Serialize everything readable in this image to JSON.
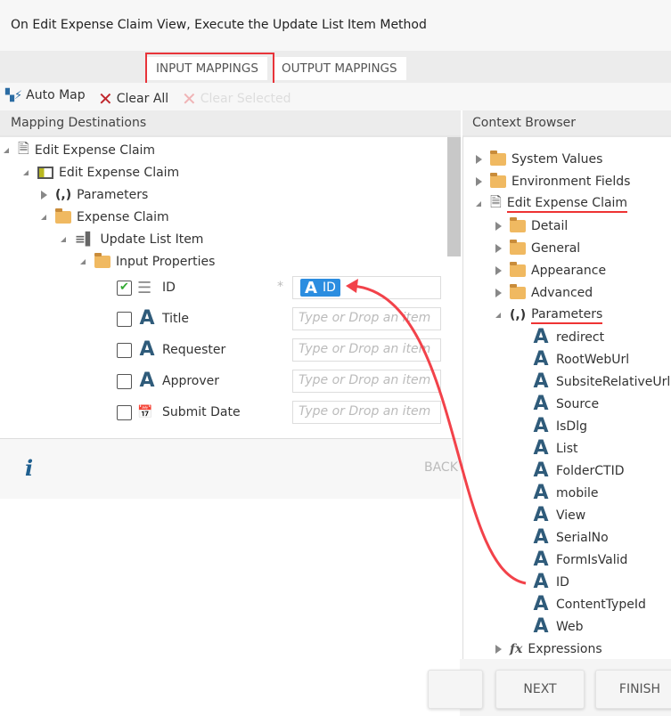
{
  "title": "On Edit Expense Claim View, Execute the Update List Item Method",
  "tabs": {
    "input": "INPUT MAPPINGS",
    "output": "OUTPUT MAPPINGS"
  },
  "toolbar": {
    "auto_map": "Auto Map",
    "clear_all": "Clear All",
    "clear_selected": "Clear Selected"
  },
  "left": {
    "header": "Mapping Destinations",
    "tree": {
      "root": "Edit Expense Claim",
      "view": "Edit Expense Claim",
      "parameters": "Parameters",
      "expense_claim": "Expense Claim",
      "method": "Update List Item",
      "input_props": "Input Properties"
    },
    "props": [
      {
        "label": "ID",
        "checked": true,
        "value": "ID",
        "required_mark": "*"
      },
      {
        "label": "Title",
        "placeholder": "Type or Drop an item"
      },
      {
        "label": "Requester",
        "placeholder": "Type or Drop an item"
      },
      {
        "label": "Approver",
        "placeholder": "Type or Drop an item"
      },
      {
        "label": "Submit Date",
        "placeholder": "Type or Drop an item"
      }
    ]
  },
  "footer": {
    "info": "i",
    "back": "BACK",
    "next": "NEXT",
    "finish": "FINISH"
  },
  "right": {
    "header": "Context Browser",
    "system_values": "System Values",
    "environment_fields": "Environment Fields",
    "edit_expense_claim": "Edit Expense Claim",
    "detail": "Detail",
    "general": "General",
    "appearance": "Appearance",
    "advanced": "Advanced",
    "parameters": "Parameters",
    "params": [
      "redirect",
      "RootWebUrl",
      "SubsiteRelativeUrl",
      "Source",
      "IsDlg",
      "List",
      "FolderCTID",
      "mobile",
      "View",
      "SerialNo",
      "FormIsValid",
      "ID",
      "ContentTypeId",
      "Web"
    ],
    "expressions": "Expressions"
  },
  "colors": {
    "highlight": "#e8343a",
    "chip": "#2b8de0",
    "icon": "#2f5b7a"
  }
}
